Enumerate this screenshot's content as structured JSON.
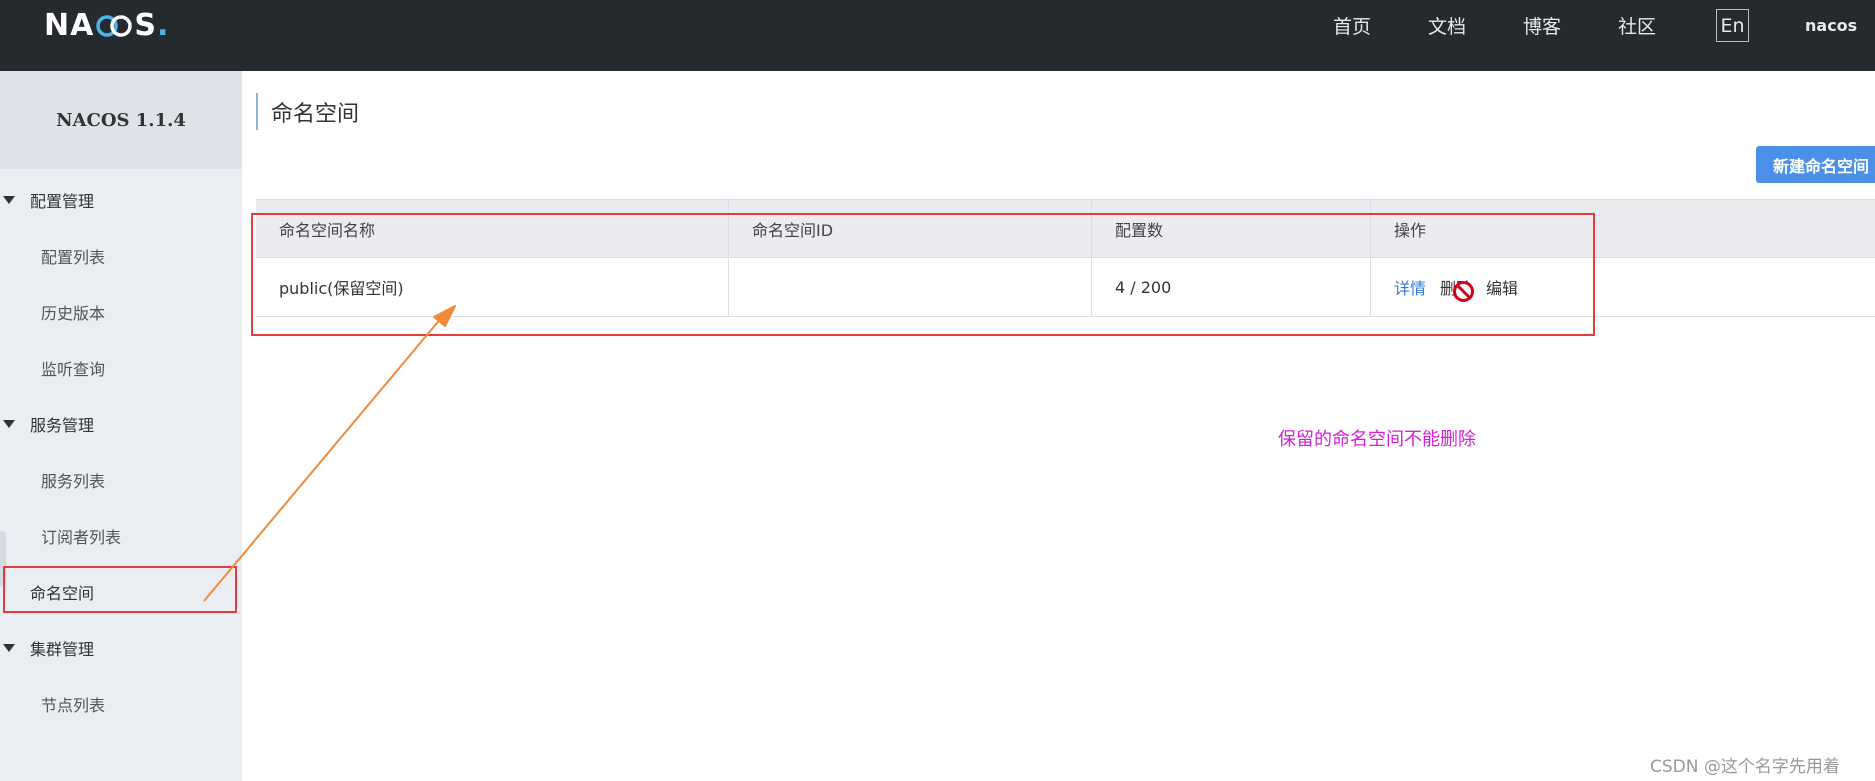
{
  "topbar": {
    "logo_pre": "NA",
    "logo_post": "S",
    "logo_dot": ".",
    "nav": [
      "首页",
      "文档",
      "博客",
      "社区"
    ],
    "lang": "En",
    "user": "nacos"
  },
  "sidebar": {
    "title": "NACOS 1.1.4",
    "groups": [
      {
        "label": "配置管理",
        "items": [
          "配置列表",
          "历史版本",
          "监听查询"
        ]
      },
      {
        "label": "服务管理",
        "items": [
          "服务列表",
          "订阅者列表"
        ]
      },
      {
        "label": "命名空间"
      },
      {
        "label": "集群管理",
        "items": [
          "节点列表"
        ]
      }
    ]
  },
  "main": {
    "title": "命名空间",
    "new_button": "新建命名空间",
    "table": {
      "headers": [
        "命名空间名称",
        "命名空间ID",
        "配置数",
        "操作"
      ],
      "rows": [
        {
          "name": "public(保留空间)",
          "id": "",
          "count": "4 / 200",
          "actions": [
            "详情",
            "删除",
            "编辑"
          ]
        }
      ]
    }
  },
  "annotation": {
    "note": "保留的命名空间不能删除",
    "colors": {
      "box": "#e53c3c",
      "arrow": "#f08a3c",
      "note": "#d91ed9"
    }
  },
  "watermark": "CSDN @这个名字先用着"
}
